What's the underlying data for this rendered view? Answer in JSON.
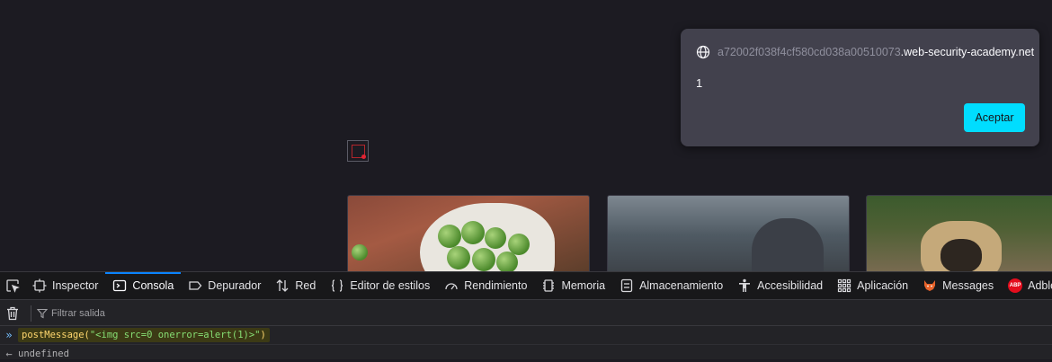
{
  "alert": {
    "origin_prefix": "a72002f038f4cf580cd038a00510073",
    "origin_suffix": ".web-security-academy.net",
    "message": "1",
    "accept_label": "Aceptar"
  },
  "devtools": {
    "tabs": [
      {
        "label": "Inspector",
        "icon": "inspector-icon"
      },
      {
        "label": "Consola",
        "icon": "console-icon",
        "active": true
      },
      {
        "label": "Depurador",
        "icon": "debugger-icon"
      },
      {
        "label": "Red",
        "icon": "network-icon"
      },
      {
        "label": "Editor de estilos",
        "icon": "style-editor-icon"
      },
      {
        "label": "Rendimiento",
        "icon": "performance-icon"
      },
      {
        "label": "Memoria",
        "icon": "memory-icon"
      },
      {
        "label": "Almacenamiento",
        "icon": "storage-icon"
      },
      {
        "label": "Accesibilidad",
        "icon": "accessibility-icon"
      },
      {
        "label": "Aplicación",
        "icon": "application-icon"
      },
      {
        "label": "Messages",
        "icon": "fox-icon"
      },
      {
        "label": "Adblock Plus",
        "icon": "abp-icon"
      }
    ],
    "filter_placeholder": "Filtrar salida",
    "console": {
      "input_fn": "postMessage(",
      "input_str": "\"<img src=0 onerror=alert(1)>\"",
      "input_close": ")",
      "output": "undefined"
    }
  },
  "colors": {
    "accent_button": "#00ddff",
    "active_tab": "#0a84ff",
    "page_background": "#1c1b22"
  }
}
